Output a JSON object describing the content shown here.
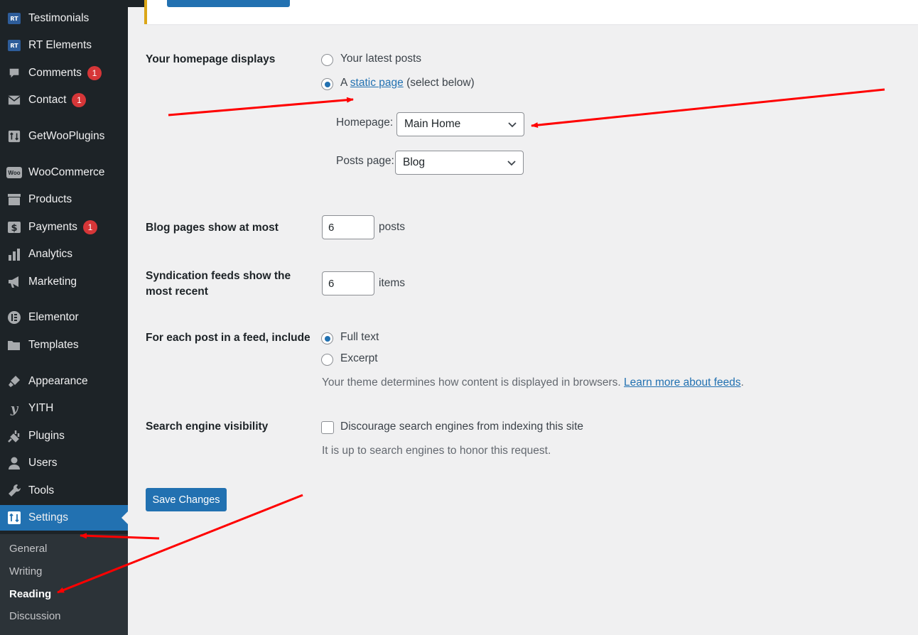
{
  "sidebar": {
    "items": [
      {
        "label": "Testimonials",
        "icon": "rt-icon",
        "badge": ""
      },
      {
        "label": "RT Elements",
        "icon": "rt-icon",
        "badge": ""
      },
      {
        "label": "Comments",
        "icon": "comment-icon",
        "badge": "1"
      },
      {
        "label": "Contact",
        "icon": "mail-icon",
        "badge": "1"
      },
      {
        "label": "GetWooPlugins",
        "icon": "plugin-bars-icon",
        "badge": ""
      },
      {
        "label": "WooCommerce",
        "icon": "woo-icon",
        "badge": ""
      },
      {
        "label": "Products",
        "icon": "archive-icon",
        "badge": ""
      },
      {
        "label": "Payments",
        "icon": "dollar-icon",
        "badge": "1"
      },
      {
        "label": "Analytics",
        "icon": "bar-chart-icon",
        "badge": ""
      },
      {
        "label": "Marketing",
        "icon": "megaphone-icon",
        "badge": ""
      },
      {
        "label": "Elementor",
        "icon": "elementor-icon",
        "badge": ""
      },
      {
        "label": "Templates",
        "icon": "folder-icon",
        "badge": ""
      },
      {
        "label": "Appearance",
        "icon": "brush-icon",
        "badge": ""
      },
      {
        "label": "YITH",
        "icon": "yith-icon",
        "badge": ""
      },
      {
        "label": "Plugins",
        "icon": "plug-icon",
        "badge": ""
      },
      {
        "label": "Users",
        "icon": "user-icon",
        "badge": ""
      },
      {
        "label": "Tools",
        "icon": "wrench-icon",
        "badge": ""
      },
      {
        "label": "Settings",
        "icon": "settings-icon",
        "badge": ""
      }
    ],
    "submenu": [
      "General",
      "Writing",
      "Reading",
      "Discussion"
    ],
    "rt_icon_text": "RT",
    "woo_icon_text": "Woo"
  },
  "homepage": {
    "label": "Your homepage displays",
    "option_latest": "Your latest posts",
    "option_static_prefix": "A ",
    "option_static_link": "static page",
    "option_static_suffix": " (select below)",
    "homepage_label": "Homepage:",
    "homepage_value": "Main Home",
    "posts_page_label": "Posts page:",
    "posts_page_value": "Blog"
  },
  "blog_pages": {
    "label": "Blog pages show at most",
    "value": "6",
    "unit": "posts"
  },
  "syndication": {
    "label_line1": "Syndication feeds show the",
    "label_line2": "most recent",
    "value": "6",
    "unit": "items"
  },
  "feed": {
    "label": "For each post in a feed, include",
    "option_full": "Full text",
    "option_excerpt": "Excerpt",
    "desc": "Your theme determines how content is displayed in browsers. ",
    "desc_link": "Learn more about feeds",
    "desc_end": "."
  },
  "search": {
    "label": "Search engine visibility",
    "checkbox_label": "Discourage search engines from indexing this site",
    "desc": "It is up to search engines to honor this request."
  },
  "save_button": "Save Changes",
  "colors": {
    "accent": "#2271b1",
    "sidebar": "#1d2327",
    "badge": "#d63638",
    "annotation_arrow": "#ff0000"
  }
}
